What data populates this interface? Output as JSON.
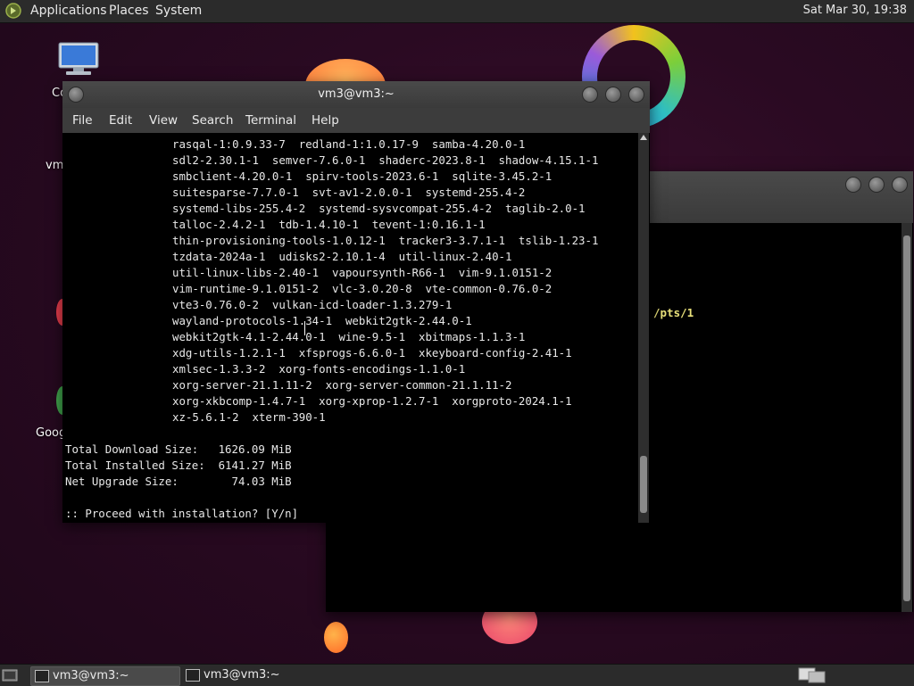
{
  "panel": {
    "menus": [
      "Applications",
      "Places",
      "System"
    ],
    "clock": "Sat Mar 30, 19:38"
  },
  "desktop": {
    "icon_labels": [
      "Co",
      "vm",
      "Goog"
    ]
  },
  "terminal_main": {
    "title": "vm3@vm3:~",
    "menu": [
      "File",
      "Edit",
      "View",
      "Search",
      "Terminal",
      "Help"
    ],
    "package_lines": [
      "rasqal-1:0.9.33-7  redland-1:1.0.17-9  samba-4.20.0-1",
      "sdl2-2.30.1-1  semver-7.6.0-1  shaderc-2023.8-1  shadow-4.15.1-1",
      "smbclient-4.20.0-1  spirv-tools-2023.6-1  sqlite-3.45.2-1",
      "suitesparse-7.7.0-1  svt-av1-2.0.0-1  systemd-255.4-2",
      "systemd-libs-255.4-2  systemd-sysvcompat-255.4-2  taglib-2.0-1",
      "talloc-2.4.2-1  tdb-1.4.10-1  tevent-1:0.16.1-1",
      "thin-provisioning-tools-1.0.12-1  tracker3-3.7.1-1  tslib-1.23-1",
      "tzdata-2024a-1  udisks2-2.10.1-4  util-linux-2.40-1",
      "util-linux-libs-2.40-1  vapoursynth-R66-1  vim-9.1.0151-2",
      "vim-runtime-9.1.0151-2  vlc-3.0.20-8  vte-common-0.76.0-2",
      "vte3-0.76.0-2  vulkan-icd-loader-1.3.279-1",
      "wayland-protocols-1.34-1  webkit2gtk-2.44.0-1",
      "webkit2gtk-4.1-2.44.0-1  wine-9.5-1  xbitmaps-1.1.3-1",
      "xdg-utils-1.2.1-1  xfsprogs-6.6.0-1  xkeyboard-config-2.41-1",
      "xmlsec-1.3.3-2  xorg-fonts-encodings-1.1.0-1",
      "xorg-server-21.1.11-2  xorg-server-common-21.1.11-2",
      "xorg-xkbcomp-1.4.7-1  xorg-xprop-1.2.7-1  xorgproto-2024.1-1",
      "xz-5.6.1-2  xterm-390-1"
    ],
    "summary": [
      "Total Download Size:   1626.09 MiB",
      "Total Installed Size:  6141.27 MiB",
      "Net Upgrade Size:        74.03 MiB"
    ],
    "prompt": ":: Proceed with installation? [Y/n]"
  },
  "terminal_back": {
    "visible_text": "/pts/1"
  },
  "taskbar": {
    "tasks": [
      "vm3@vm3:~",
      "vm3@vm3:~"
    ]
  },
  "colors": {
    "desktop_bg": "#2a0a22",
    "panel_bg": "#2b2b2b",
    "terminal_fg": "#e8e8e8",
    "pts_text": "#e8e07a"
  }
}
